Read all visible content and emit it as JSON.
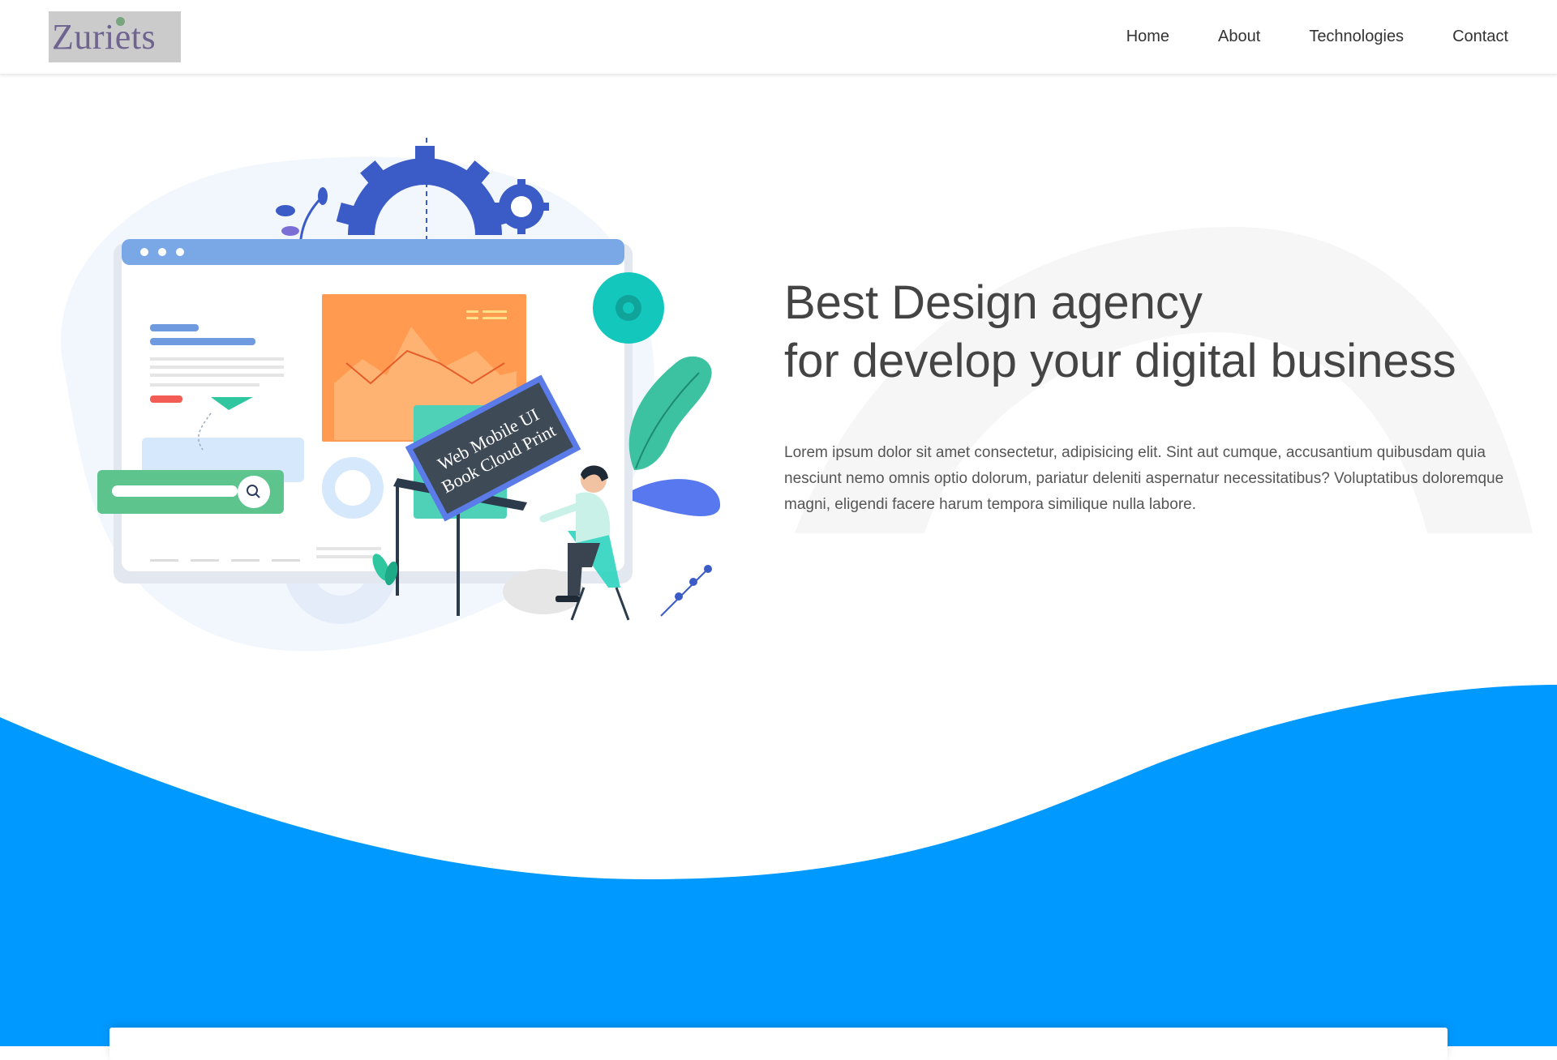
{
  "brand": {
    "logo_text": "Zuriets"
  },
  "nav": {
    "items": [
      {
        "label": "Home"
      },
      {
        "label": "About"
      },
      {
        "label": "Technologies"
      },
      {
        "label": "Contact"
      }
    ]
  },
  "hero": {
    "title_line1": "Best Design agency",
    "title_line2": "for develop your digital business",
    "description": "Lorem ipsum dolor sit amet consectetur, adipisicing elit. Sint aut cumque, accusantium quibusdam quia nesciunt nemo omnis optio dolorum, pariatur deleniti aspernatur necessitatibus? Voluptatibus doloremque magni, eligendi facere harum tempora similique nulla labore.",
    "illustration": {
      "board_line1": "Web Mobile UI",
      "board_line2": "Book Cloud Print"
    }
  },
  "colors": {
    "wave_blue": "#0099ff",
    "accent_teal": "#2dd4bf",
    "accent_orange": "#ff8a3d",
    "illustration_blue": "#3b5bc7"
  },
  "icons": {
    "search": "search-icon",
    "paper_plane": "paper-plane-icon",
    "gear": "gear-icon"
  }
}
